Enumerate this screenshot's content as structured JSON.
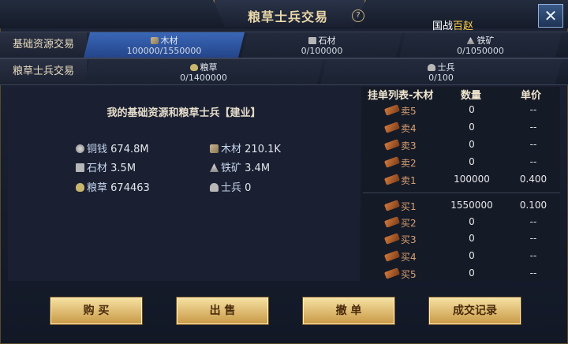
{
  "title": "粮草士兵交易",
  "help_symbol": "?",
  "war_label": {
    "a": "国战",
    "b": "百",
    "c": "赵"
  },
  "close_symbol": "✕",
  "rows": {
    "basic_label": "基础资源交易",
    "troop_label": "粮草士兵交易",
    "basic": [
      {
        "name": "木材",
        "value": "100000/1550000",
        "icon": "wood-icon",
        "active": true
      },
      {
        "name": "石材",
        "value": "0/100000",
        "icon": "stone-icon"
      },
      {
        "name": "铁矿",
        "value": "0/1050000",
        "icon": "iron-icon"
      }
    ],
    "troop": [
      {
        "name": "粮草",
        "value": "0/1400000",
        "icon": "grain-icon"
      },
      {
        "name": "士兵",
        "value": "0/100",
        "icon": "soldier-icon"
      }
    ]
  },
  "my_resources": {
    "title": "我的基础资源和粮草士兵【建业】",
    "items": [
      {
        "name": "铜钱",
        "value": "674.8M",
        "icon": "coin-icon"
      },
      {
        "name": "木材",
        "value": "210.1K",
        "icon": "wood-icon"
      },
      {
        "name": "石材",
        "value": "3.5M",
        "icon": "stone-icon"
      },
      {
        "name": "铁矿",
        "value": "3.4M",
        "icon": "iron-icon"
      },
      {
        "name": "粮草",
        "value": "674463",
        "icon": "grain-icon"
      },
      {
        "name": "士兵",
        "value": "0",
        "icon": "soldier-icon"
      }
    ]
  },
  "order_list": {
    "header": {
      "col1": "挂单列表-木材",
      "col2": "数量",
      "col3": "单价"
    },
    "sell": [
      {
        "label": "卖5",
        "qty": "0",
        "price": "--"
      },
      {
        "label": "卖4",
        "qty": "0",
        "price": "--"
      },
      {
        "label": "卖3",
        "qty": "0",
        "price": "--"
      },
      {
        "label": "卖2",
        "qty": "0",
        "price": "--"
      },
      {
        "label": "卖1",
        "qty": "100000",
        "price": "0.400"
      }
    ],
    "buy": [
      {
        "label": "买1",
        "qty": "1550000",
        "price": "0.100"
      },
      {
        "label": "买2",
        "qty": "0",
        "price": "--"
      },
      {
        "label": "买3",
        "qty": "0",
        "price": "--"
      },
      {
        "label": "买4",
        "qty": "0",
        "price": "--"
      },
      {
        "label": "买5",
        "qty": "0",
        "price": "--"
      }
    ]
  },
  "buttons": {
    "buy": "购 买",
    "sell": "出 售",
    "cancel": "撤 单",
    "records": "成交记录"
  }
}
